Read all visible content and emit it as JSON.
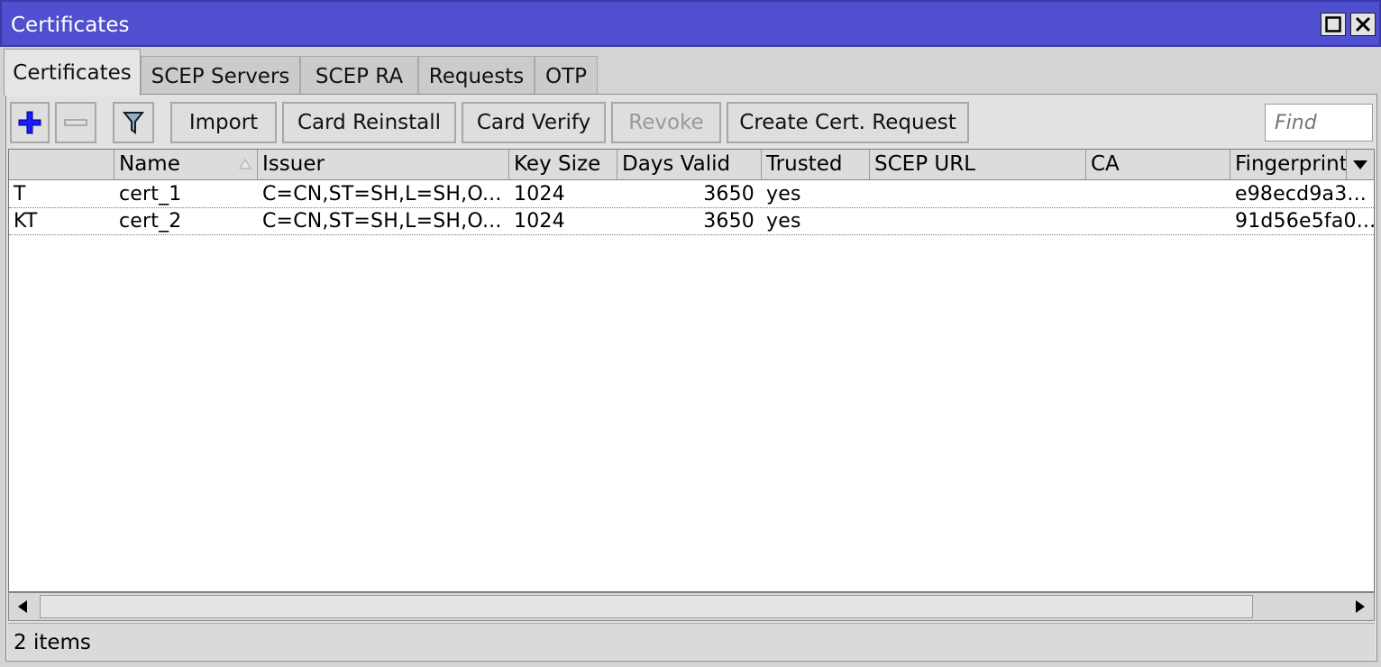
{
  "window": {
    "title": "Certificates"
  },
  "tabs": [
    {
      "label": "Certificates",
      "active": true
    },
    {
      "label": "SCEP Servers",
      "active": false
    },
    {
      "label": "SCEP RA",
      "active": false
    },
    {
      "label": "Requests",
      "active": false
    },
    {
      "label": "OTP",
      "active": false
    }
  ],
  "toolbar": {
    "icons": [
      "add-icon",
      "remove-icon",
      "filter-icon"
    ],
    "buttons": [
      {
        "label": "Import",
        "enabled": true
      },
      {
        "label": "Card Reinstall",
        "enabled": true
      },
      {
        "label": "Card Verify",
        "enabled": true
      },
      {
        "label": "Revoke",
        "enabled": false
      },
      {
        "label": "Create Cert. Request",
        "enabled": true
      }
    ],
    "find_placeholder": "Find"
  },
  "table": {
    "columns": [
      "",
      "Name",
      "Issuer",
      "Key Size",
      "Days Valid",
      "Trusted",
      "SCEP URL",
      "CA",
      "Fingerprint"
    ],
    "sorted_column": "Name",
    "rows": [
      {
        "flags": "T",
        "name": "cert_1",
        "issuer": "C=CN,ST=SH,L=SH,O...",
        "key_size": "1024",
        "days_valid": "3650",
        "trusted": "yes",
        "scep_url": "",
        "ca": "",
        "fingerprint": "e98ecd9a3..."
      },
      {
        "flags": "KT",
        "name": "cert_2",
        "issuer": "C=CN,ST=SH,L=SH,O...",
        "key_size": "1024",
        "days_valid": "3650",
        "trusted": "yes",
        "scep_url": "",
        "ca": "",
        "fingerprint": "91d56e5fa0..."
      }
    ]
  },
  "status": {
    "text": "2 items"
  },
  "colors": {
    "titlebar": "#4f4fcf",
    "add_icon": "#1a1aff",
    "disabled_text": "#9a9a9a"
  }
}
